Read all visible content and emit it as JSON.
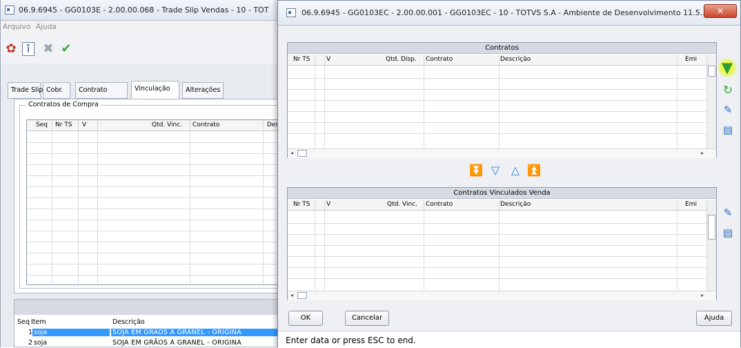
{
  "back_window": {
    "title": "06.9.6945 - GG0103E - 2.00.00.068 - Trade Slip Vendas - 10 - TOT",
    "menu": [
      "Arquivo",
      "Ajuda"
    ],
    "tabs": [
      "Trade Slip",
      "Cobr.",
      "Contrato",
      "Vinculação",
      "Alterações"
    ],
    "active_tab": "Vinculação",
    "group_label": "Contratos de Compra",
    "grid_columns": [
      "Seq",
      "Nr TS",
      "V",
      "Qtd. Vinc.",
      "Contrato",
      "Des"
    ],
    "bottom_columns": [
      "Seq",
      "Item",
      "Descrição"
    ],
    "bottom_rows": [
      {
        "seq": "1",
        "item": "soja",
        "descricao": "SOJA EM GRÃOS A GRANEL - ORIGINA"
      },
      {
        "seq": "2",
        "item": "soja",
        "descricao": "SOJA EM GRÃOS A GRANEL - ORIGINA"
      }
    ]
  },
  "front_window": {
    "title": "06.9.6945 - GG0103EC - 2.00.00.001 - GG0103EC - 10 - TOTVS S.A - Ambiente de Desenvolvimento 11.5...",
    "close_label": "✕",
    "grid1": {
      "title": "Contratos",
      "columns": [
        "Nr TS",
        "V",
        "Qtd. Disp.",
        "Contrato",
        "Descrição",
        "Emi"
      ]
    },
    "grid2": {
      "title": "Contratos Vinculados Venda",
      "columns": [
        "Nr TS",
        "V",
        "Qtd. Vinc.",
        "Contrato",
        "Descrição",
        "Emi"
      ]
    },
    "buttons": {
      "ok": "OK",
      "cancel": "Cancelar",
      "help": "Ajuda"
    },
    "status": "Enter data or press ESC to end."
  },
  "icons": {
    "back_toolbar": [
      "settings-icon",
      "report-icon",
      "cancel-icon",
      "confirm-icon"
    ],
    "right_tools": [
      "filter-icon",
      "refresh-icon",
      "edit-icon",
      "tree-icon"
    ],
    "move_buttons": [
      "move-all-down-icon",
      "move-down-icon",
      "move-up-icon",
      "move-all-up-icon"
    ]
  }
}
